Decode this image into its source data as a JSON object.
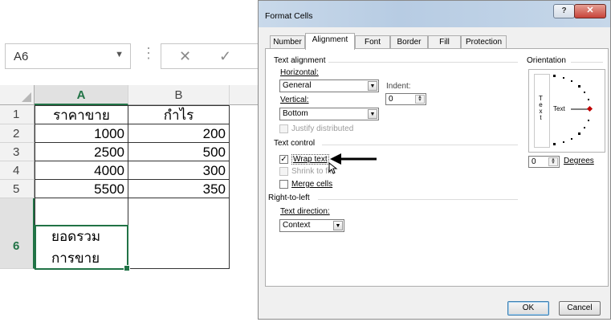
{
  "formula_bar": {
    "name_box": "A6",
    "name_box_arrow": "▼",
    "separator": "⋮",
    "cancel_glyph": "✕",
    "enter_glyph": "✓"
  },
  "sheet": {
    "columns": [
      "A",
      "B"
    ],
    "rows": [
      {
        "num": "1",
        "a": "ราคาขาย",
        "b": "กำไร"
      },
      {
        "num": "2",
        "a": "1000",
        "b": "200"
      },
      {
        "num": "3",
        "a": "2500",
        "b": "500"
      },
      {
        "num": "4",
        "a": "4000",
        "b": "300"
      },
      {
        "num": "5",
        "a": "5500",
        "b": "350"
      },
      {
        "num": "6",
        "a_line1": "ยอดรวม",
        "a_line2": "การขาย",
        "b": ""
      }
    ]
  },
  "dialog": {
    "title": "Format Cells",
    "help_glyph": "?",
    "close_glyph": "✕",
    "tabs": [
      "Number",
      "Alignment",
      "Font",
      "Border",
      "Fill",
      "Protection"
    ],
    "active_tab": "Alignment",
    "text_alignment": {
      "title": "Text alignment",
      "horizontal_label": "Horizontal:",
      "horizontal_value": "General",
      "indent_label": "Indent:",
      "indent_value": "0",
      "vertical_label": "Vertical:",
      "vertical_value": "Bottom",
      "justify_distributed": "Justify distributed"
    },
    "text_control": {
      "title": "Text control",
      "wrap_text": "Wrap text",
      "wrap_checked": true,
      "shrink_to_fit": "Shrink to fit",
      "merge_cells": "Merge cells"
    },
    "right_to_left": {
      "title": "Right-to-left",
      "text_direction_label": "Text direction:",
      "text_direction_value": "Context"
    },
    "orientation": {
      "title": "Orientation",
      "vertical_text": [
        "T",
        "e",
        "x",
        "t"
      ],
      "text_label": "Text",
      "degrees_value": "0",
      "degrees_label": "Degrees"
    },
    "buttons": {
      "ok": "OK",
      "cancel": "Cancel"
    }
  },
  "colors": {
    "excel_green": "#217346",
    "orientation_marker": "#c00000",
    "annotation_arrow": "#000000"
  }
}
